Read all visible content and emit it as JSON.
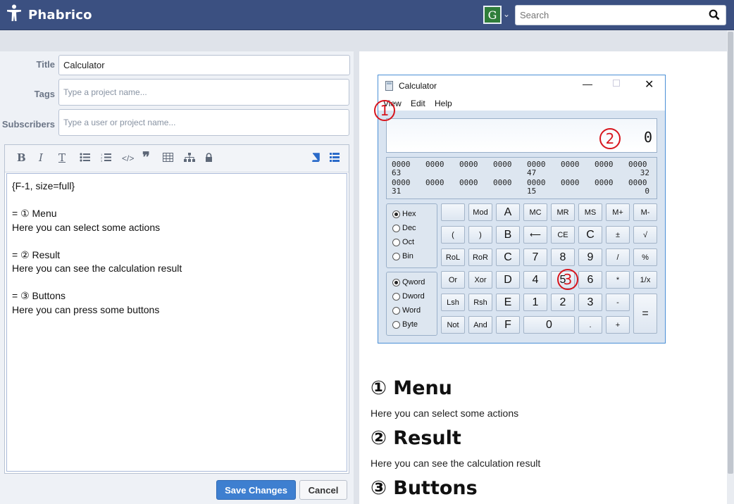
{
  "app": {
    "name": "Phabrico"
  },
  "header": {
    "avatar_letter": "G",
    "search_placeholder": "Search"
  },
  "form": {
    "title_label": "Title",
    "title_value": "Calculator",
    "tags_label": "Tags",
    "tags_placeholder": "Type a project name...",
    "subscribers_label": "Subscribers",
    "subscribers_placeholder": "Type a user or project name..."
  },
  "editor": {
    "toolbar": {
      "bold": "B",
      "italic": "I",
      "heading": "T"
    },
    "content": "{F-1, size=full}\n\n= ① Menu\nHere you can select some actions\n\n= ② Result\nHere you can see the calculation result\n\n= ③ Buttons\nHere you can press some buttons"
  },
  "buttons": {
    "save": "Save Changes",
    "cancel": "Cancel"
  },
  "preview": {
    "calc": {
      "title": "Calculator",
      "menu": [
        "View",
        "Edit",
        "Help"
      ],
      "display": "0",
      "bits_row1": [
        "0000",
        "0000",
        "0000",
        "0000",
        "0000",
        "0000",
        "0000",
        "0000"
      ],
      "bits_row1_labels": [
        "63",
        "47",
        "32"
      ],
      "bits_row2": [
        "0000",
        "0000",
        "0000",
        "0000",
        "0000",
        "0000",
        "0000",
        "0000"
      ],
      "bits_row2_labels": [
        "31",
        "15",
        "0"
      ],
      "base_options": [
        "Hex",
        "Dec",
        "Oct",
        "Bin"
      ],
      "word_options": [
        "Qword",
        "Dword",
        "Word",
        "Byte"
      ],
      "keys": [
        [
          "",
          "Mod",
          "A",
          "MC",
          "MR",
          "MS",
          "M+",
          "M-"
        ],
        [
          "(",
          ")",
          "B",
          "⟵",
          "CE",
          "C",
          "±",
          "√"
        ],
        [
          "RoL",
          "RoR",
          "C",
          "7",
          "8",
          "9",
          "/",
          "%"
        ],
        [
          "Or",
          "Xor",
          "D",
          "4",
          "5",
          "6",
          "*",
          "1/x"
        ],
        [
          "Lsh",
          "Rsh",
          "E",
          "1",
          "2",
          "3",
          "-",
          "="
        ],
        [
          "Not",
          "And",
          "F",
          "0",
          "",
          ".",
          "+",
          ""
        ]
      ],
      "markers": [
        "1",
        "2",
        "3"
      ]
    },
    "sections": [
      {
        "heading": "① Menu",
        "text": "Here you can select some actions"
      },
      {
        "heading": "② Result",
        "text": "Here you can see the calculation result"
      },
      {
        "heading": "③ Buttons",
        "text": ""
      }
    ]
  }
}
